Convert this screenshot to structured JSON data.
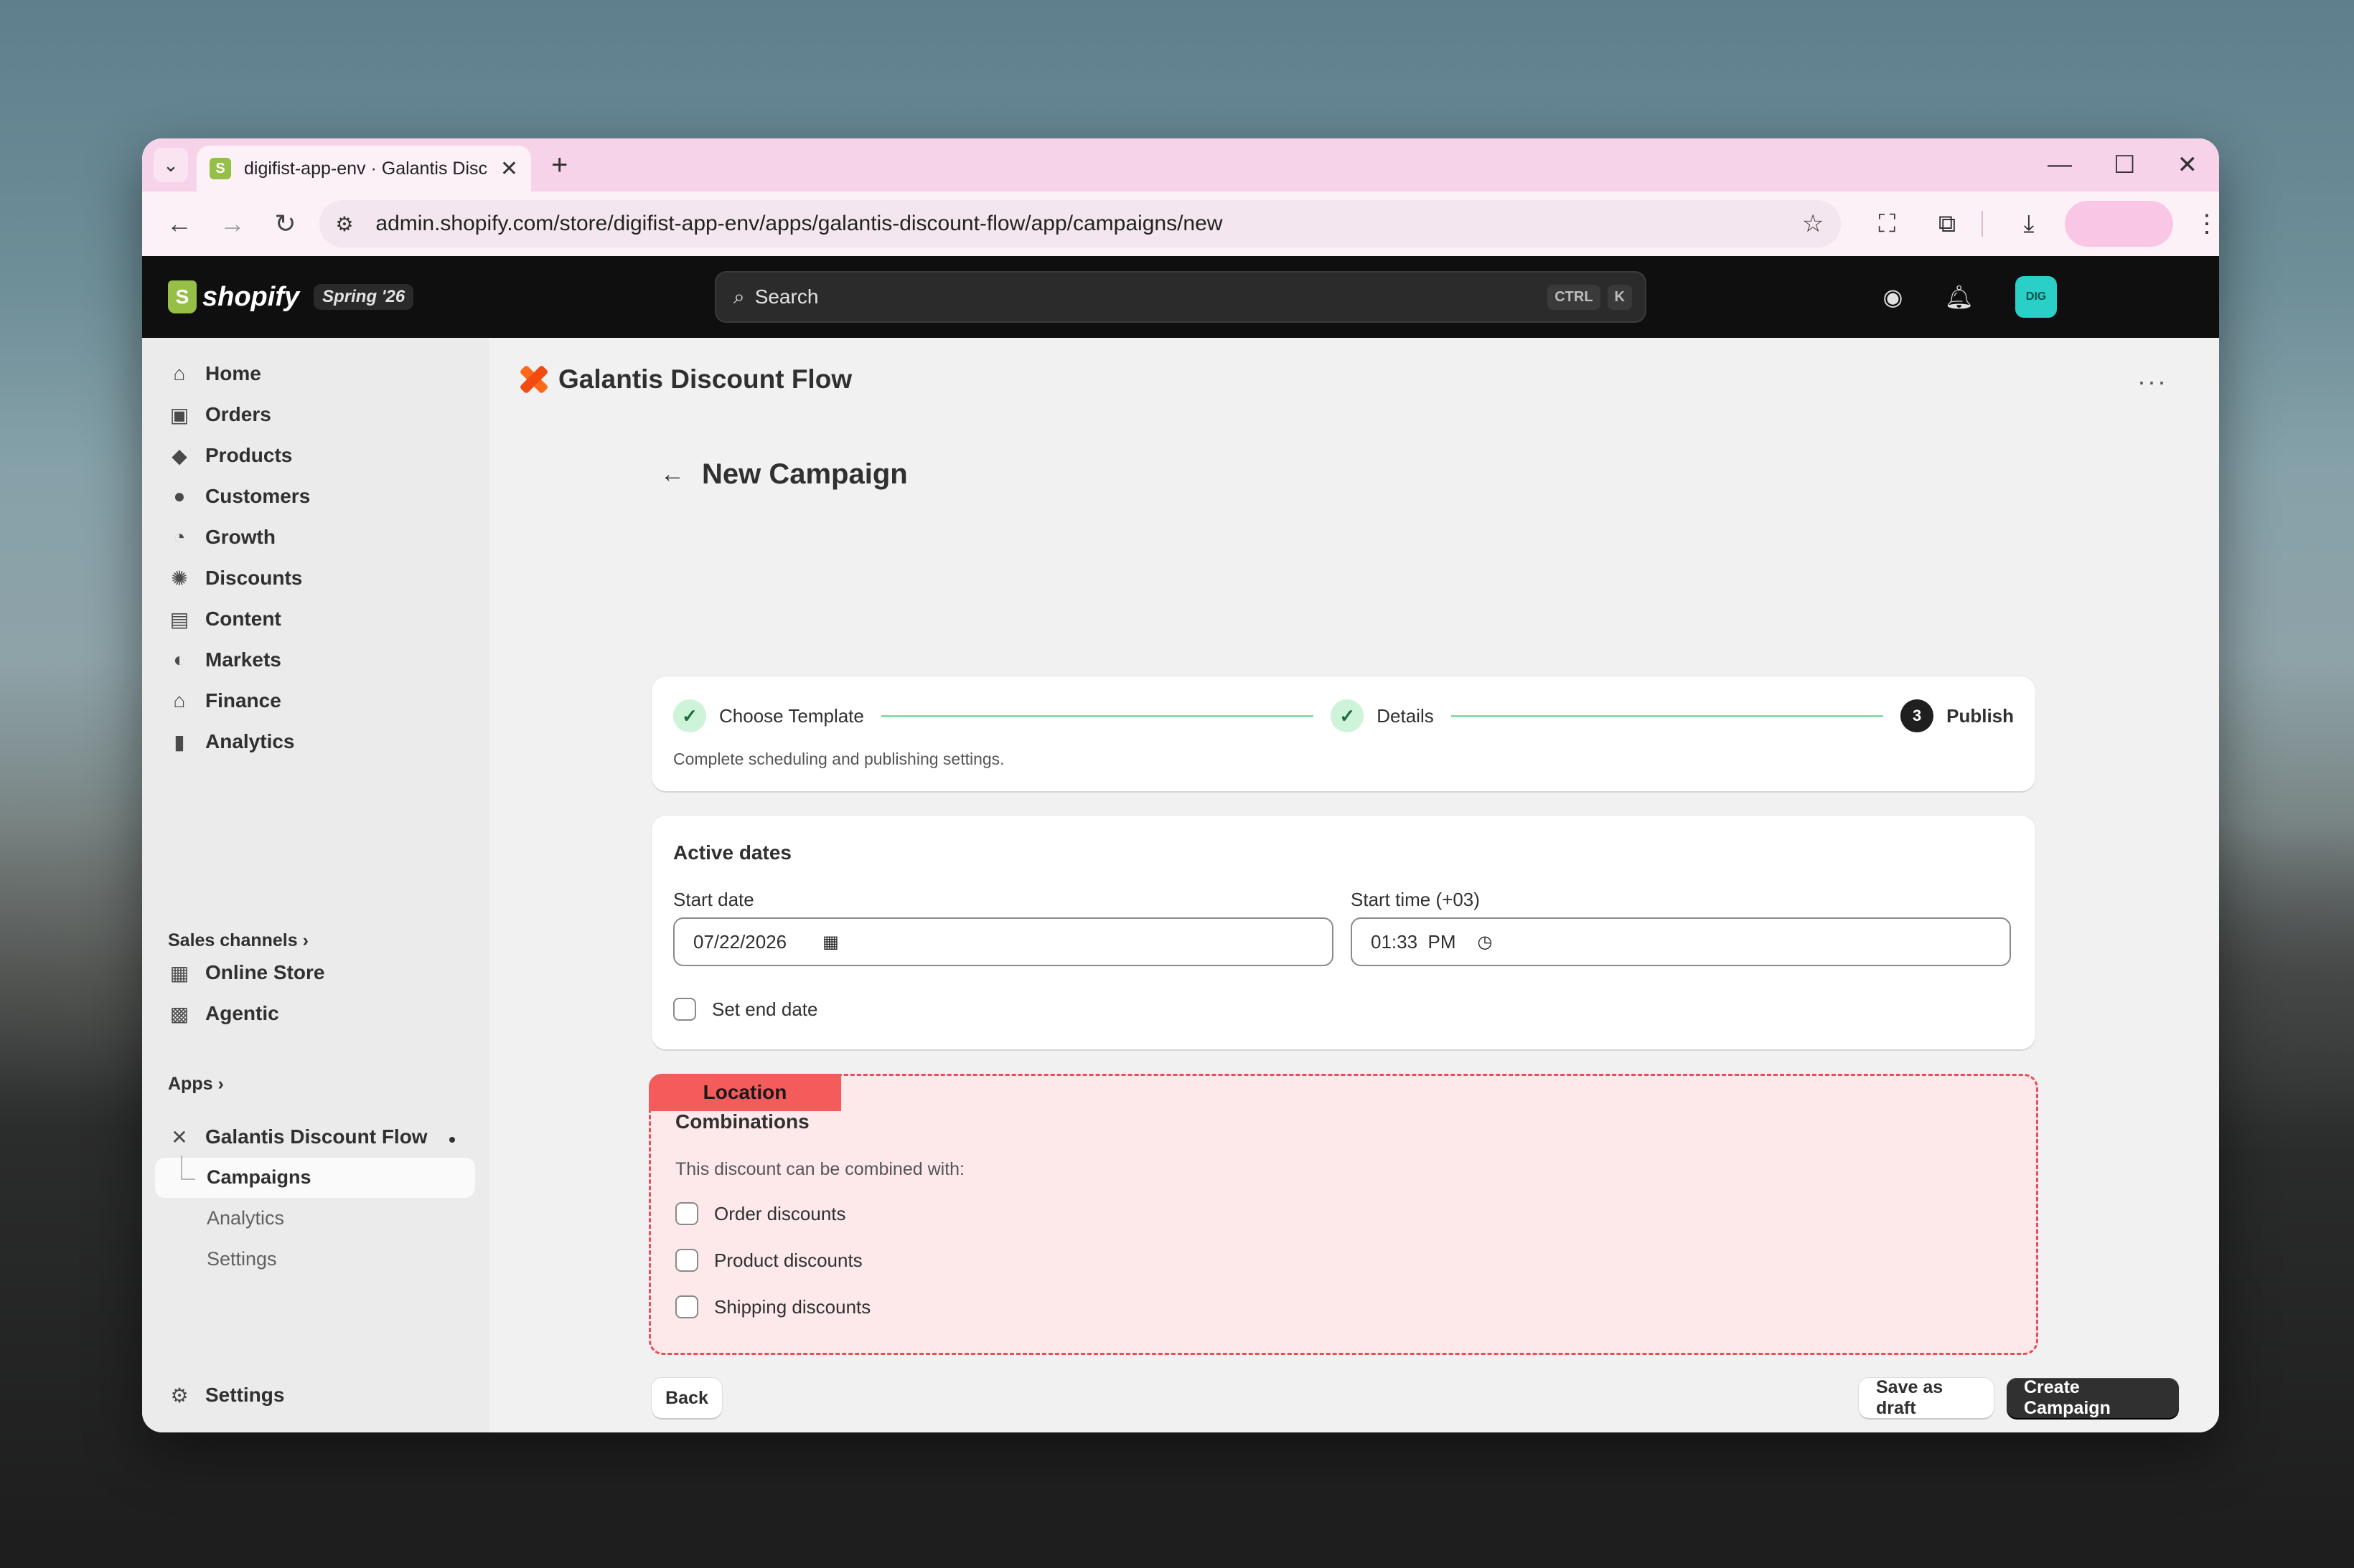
{
  "browser": {
    "tab_title": "digifist-app-env · Galantis Disco",
    "tab_favicon": "S",
    "new_tab_glyph": "+",
    "url": "admin.shopify.com/store/digifist-app-env/apps/galantis-discount-flow/app/campaigns/new",
    "icons": [
      "tab-search-icon",
      "close-icon",
      "plus-icon",
      "minimize-icon",
      "maximize-icon",
      "close-window-icon",
      "back-icon",
      "forward-icon",
      "reload-icon",
      "site-info-icon",
      "star-icon",
      "screenshot-icon",
      "extensions-icon",
      "download-icon",
      "menu-icon"
    ]
  },
  "topbar": {
    "logo_mark": "S",
    "logo_text": "shopify",
    "edition": "Spring '26",
    "search_label": "Search",
    "shortcut_keys": [
      "CTRL",
      "K"
    ],
    "avatar_initials": "DIG",
    "avatar_color": "#2ad0c7"
  },
  "sidebar": {
    "items": [
      {
        "label": "Home",
        "icon": "home-icon"
      },
      {
        "label": "Orders",
        "icon": "inbox-icon"
      },
      {
        "label": "Products",
        "icon": "tag-icon"
      },
      {
        "label": "Customers",
        "icon": "person-icon"
      },
      {
        "label": "Growth",
        "icon": "gauge-icon"
      },
      {
        "label": "Discounts",
        "icon": "discount-icon"
      },
      {
        "label": "Content",
        "icon": "content-icon"
      },
      {
        "label": "Markets",
        "icon": "globe-icon"
      },
      {
        "label": "Finance",
        "icon": "bank-icon"
      },
      {
        "label": "Analytics",
        "icon": "bar-chart-icon"
      }
    ],
    "sales_channels_title": "Sales channels",
    "sales_channels": [
      {
        "label": "Online Store",
        "icon": "store-icon"
      },
      {
        "label": "Agentic",
        "icon": "agent-icon"
      }
    ],
    "apps_title": "Apps",
    "app_name": "Galantis Discount Flow",
    "app_subitems": [
      "Campaigns",
      "Analytics",
      "Settings"
    ],
    "settings_label": "Settings"
  },
  "main": {
    "app_title": "Galantis Discount Flow",
    "page_title": "New Campaign",
    "steps": [
      {
        "label": "Choose Template",
        "state": "done"
      },
      {
        "label": "Details",
        "state": "done"
      },
      {
        "label": "Publish",
        "state": "current",
        "number": "3"
      }
    ],
    "stepper_description": "Complete scheduling and publishing settings.",
    "active_dates": {
      "title": "Active dates",
      "start_date_label": "Start date",
      "start_date_value": "07/22/2026",
      "start_time_label": "Start time (+03)",
      "start_time_value": "01:33  PM",
      "set_end_date_label": "Set end date",
      "set_end_date_checked": false
    },
    "combinations": {
      "location_tag": "Location",
      "title": "Combinations",
      "description": "This discount can be combined with:",
      "options": [
        {
          "label": "Order discounts",
          "checked": false
        },
        {
          "label": "Product discounts",
          "checked": false
        },
        {
          "label": "Shipping discounts",
          "checked": false
        }
      ]
    },
    "buttons": {
      "back": "Back",
      "save_draft": "Save as draft",
      "create": "Create Campaign"
    }
  },
  "colors": {
    "accent_green": "#8fdba9",
    "highlight_red": "#e4505a",
    "primary_button": "#303030",
    "tab_strip": "#f7d3ea"
  }
}
